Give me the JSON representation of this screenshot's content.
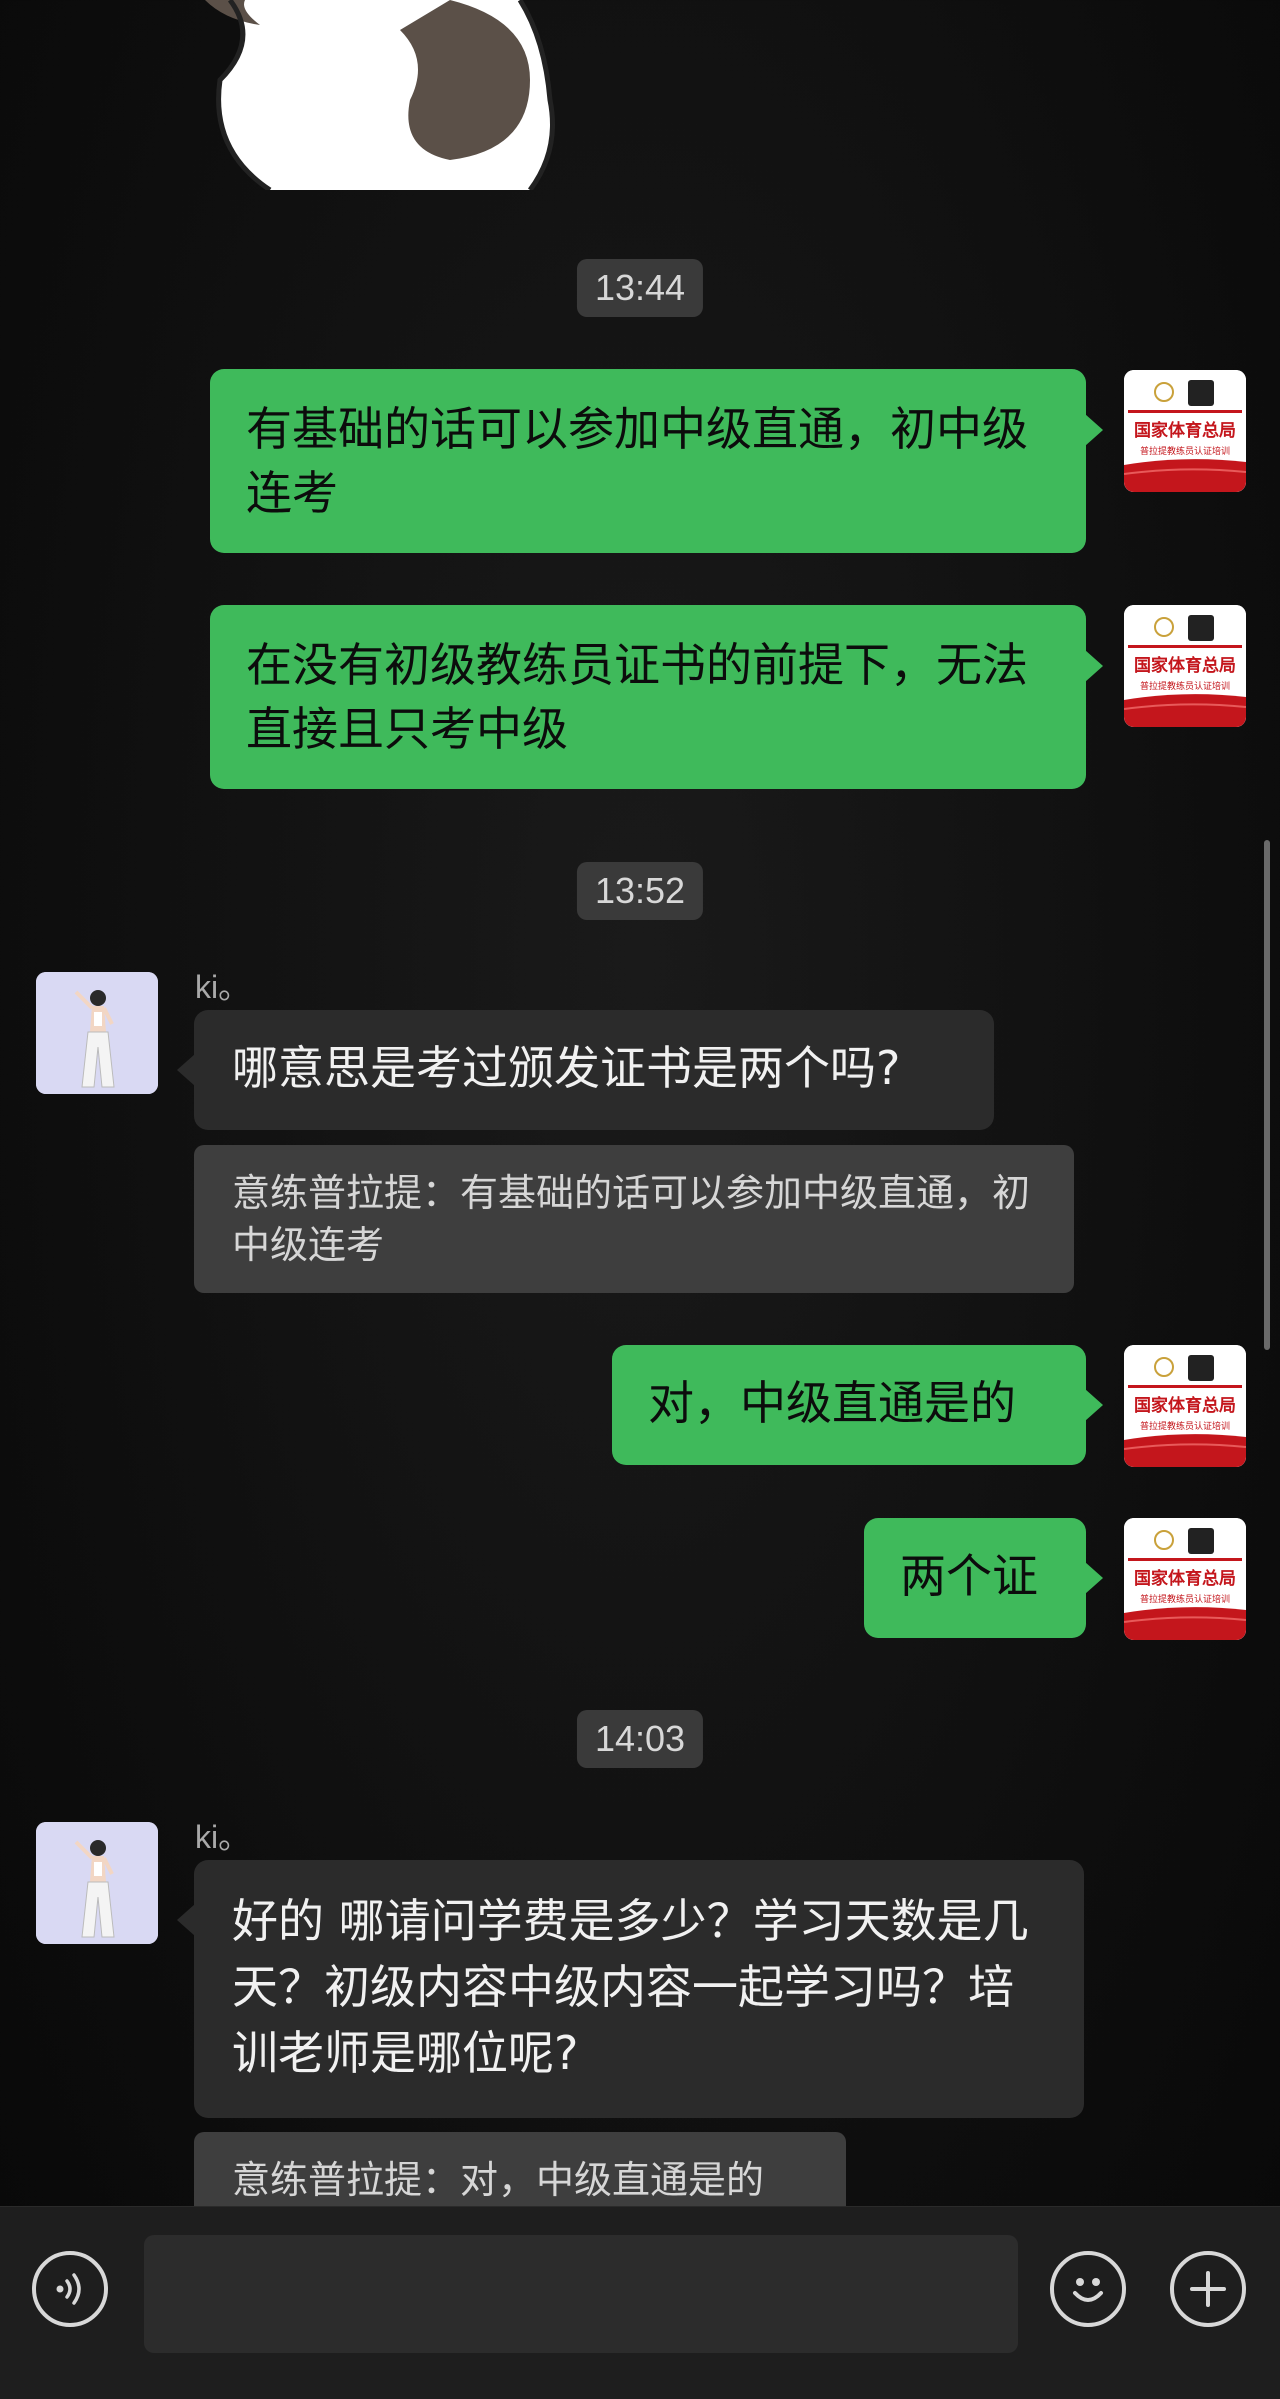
{
  "chat": {
    "messages": [
      {
        "type": "time",
        "text": "13:44"
      },
      {
        "type": "out",
        "text": "有基础的话可以参加中级直通，初中级连考"
      },
      {
        "type": "out",
        "text": "在没有初级教练员证书的前提下，无法直接且只考中级"
      },
      {
        "type": "time",
        "text": "13:52"
      },
      {
        "type": "in",
        "sender": "ki。",
        "text": "哪意思是考过颁发证书是两个吗?",
        "quote": "意练普拉提：有基础的话可以参加中级直通，初中级连考"
      },
      {
        "type": "out",
        "text": "对，中级直通是的"
      },
      {
        "type": "out",
        "text": "两个证"
      },
      {
        "type": "time",
        "text": "14:03"
      },
      {
        "type": "in",
        "sender": "ki。",
        "text": "好的 哪请问学费是多少？学习天数是几天？初级内容中级内容一起学习吗？培训老师是哪位呢?",
        "quote": "意练普拉提：对，中级直通是的"
      }
    ]
  },
  "org_avatar": {
    "title": "国家体育总局",
    "subtitle": "普拉提教练员认证培训",
    "brand_color": "#c4161c"
  },
  "input_bar": {
    "voice_icon": "voice-icon",
    "emoji_icon": "emoji-icon",
    "plus_icon": "plus-icon",
    "input_value": ""
  },
  "colors": {
    "outgoing": "#3fba5b",
    "incoming": "#2b2b2b",
    "quote": "#3e3e3e",
    "time_pill": "#3a3a3a"
  }
}
